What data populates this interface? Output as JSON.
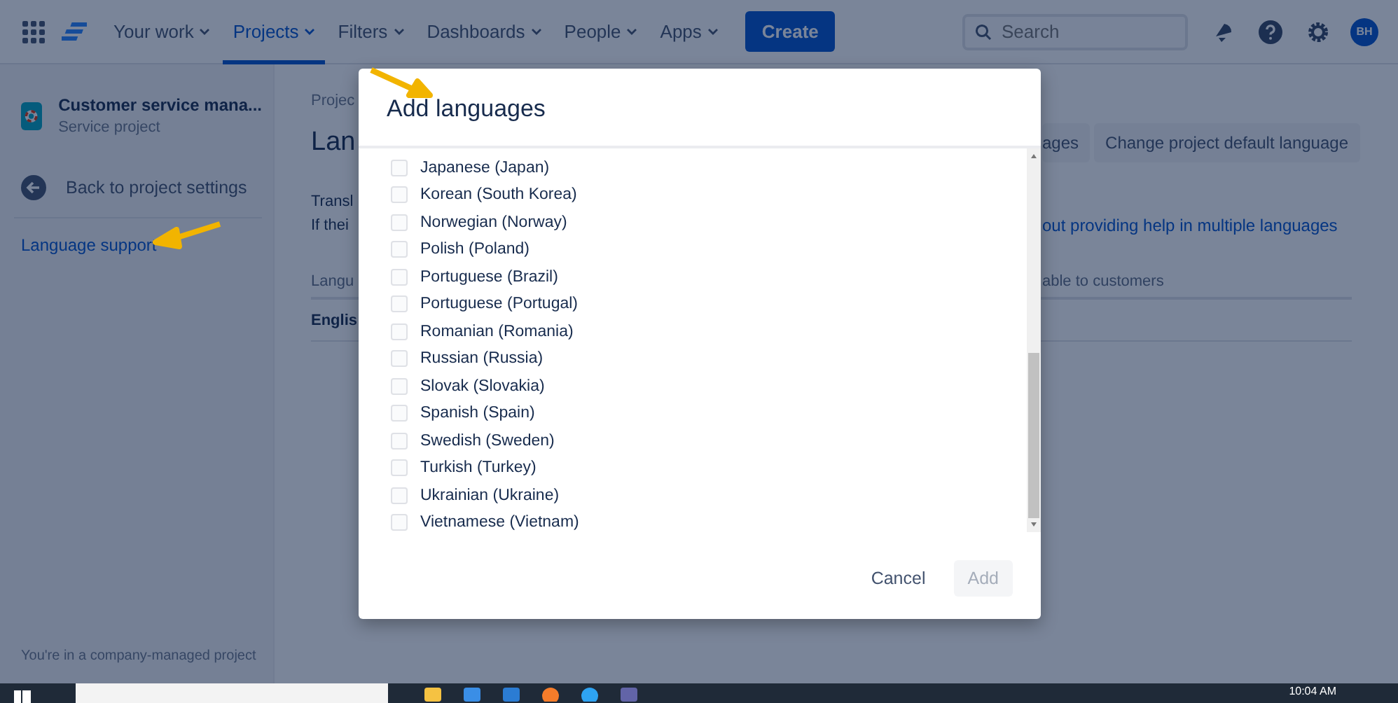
{
  "nav": {
    "items": [
      {
        "label": "Your work",
        "selected": false
      },
      {
        "label": "Projects",
        "selected": true
      },
      {
        "label": "Filters",
        "selected": false
      },
      {
        "label": "Dashboards",
        "selected": false
      },
      {
        "label": "People",
        "selected": false
      },
      {
        "label": "Apps",
        "selected": false
      }
    ],
    "create": "Create",
    "search": {
      "placeholder": "Search"
    },
    "avatar": "BH"
  },
  "sidebar": {
    "project_name": "Customer service mana...",
    "project_type": "Service project",
    "back": "Back to project settings",
    "items": [
      {
        "label": "Language support",
        "selected": true
      }
    ],
    "footer": "You're in a company-managed project"
  },
  "main": {
    "breadcrumb": "Projec",
    "title": "Lan",
    "buttons": [
      "ages",
      "Change project default language"
    ],
    "description_lines": [
      "Transl",
      "If thei"
    ],
    "help_link": "out providing help in multiple languages",
    "table": {
      "columns": [
        "Langu",
        "able to customers"
      ],
      "rows": [
        [
          "Englis"
        ]
      ]
    }
  },
  "dialog": {
    "title": "Add languages",
    "languages": [
      {
        "label": "Japanese (Japan)",
        "checked": false
      },
      {
        "label": "Korean (South Korea)",
        "checked": false
      },
      {
        "label": "Norwegian (Norway)",
        "checked": false
      },
      {
        "label": "Polish (Poland)",
        "checked": false
      },
      {
        "label": "Portuguese (Brazil)",
        "checked": false
      },
      {
        "label": "Portuguese (Portugal)",
        "checked": false
      },
      {
        "label": "Romanian (Romania)",
        "checked": false
      },
      {
        "label": "Russian (Russia)",
        "checked": false
      },
      {
        "label": "Slovak (Slovakia)",
        "checked": false
      },
      {
        "label": "Spanish (Spain)",
        "checked": false
      },
      {
        "label": "Swedish (Sweden)",
        "checked": false
      },
      {
        "label": "Turkish (Turkey)",
        "checked": false
      },
      {
        "label": "Ukrainian (Ukraine)",
        "checked": false
      },
      {
        "label": "Vietnamese (Vietnam)",
        "checked": false
      }
    ],
    "cancel": "Cancel",
    "add": {
      "label": "Add",
      "disabled": true
    }
  },
  "taskbar": {
    "clock": "10:04 AM"
  }
}
